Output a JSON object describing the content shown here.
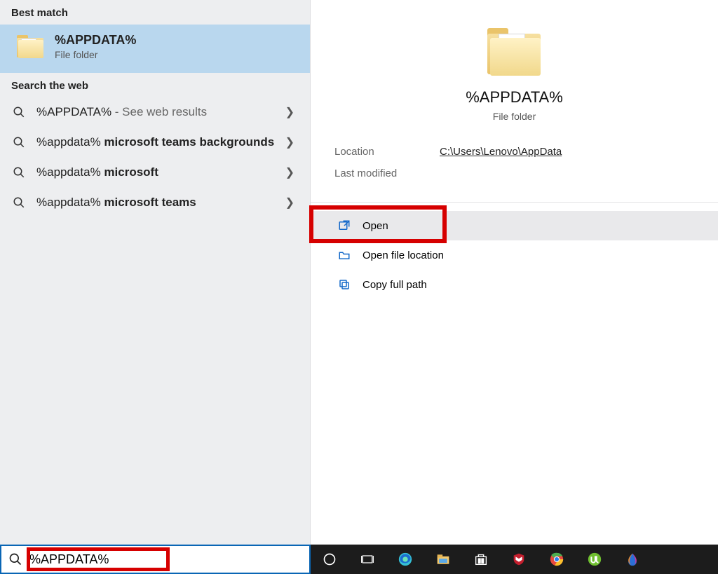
{
  "left": {
    "best_header": "Best match",
    "best_title": "%APPDATA%",
    "best_sub": "File folder",
    "web_header": "Search the web",
    "web_items": [
      {
        "prefix": "%APPDATA%",
        "bold": "",
        "tail": " - See web results"
      },
      {
        "prefix": "%appdata% ",
        "bold": "microsoft teams backgrounds",
        "tail": ""
      },
      {
        "prefix": "%appdata% ",
        "bold": "microsoft",
        "tail": ""
      },
      {
        "prefix": "%appdata% ",
        "bold": "microsoft teams",
        "tail": ""
      }
    ]
  },
  "right": {
    "title": "%APPDATA%",
    "sub": "File folder",
    "location_label": "Location",
    "location_value": "C:\\Users\\Lenovo\\AppData",
    "lastmod_label": "Last modified",
    "actions": {
      "open": "Open",
      "open_loc": "Open file location",
      "copy_path": "Copy full path"
    }
  },
  "search": {
    "value": "%APPDATA%"
  }
}
